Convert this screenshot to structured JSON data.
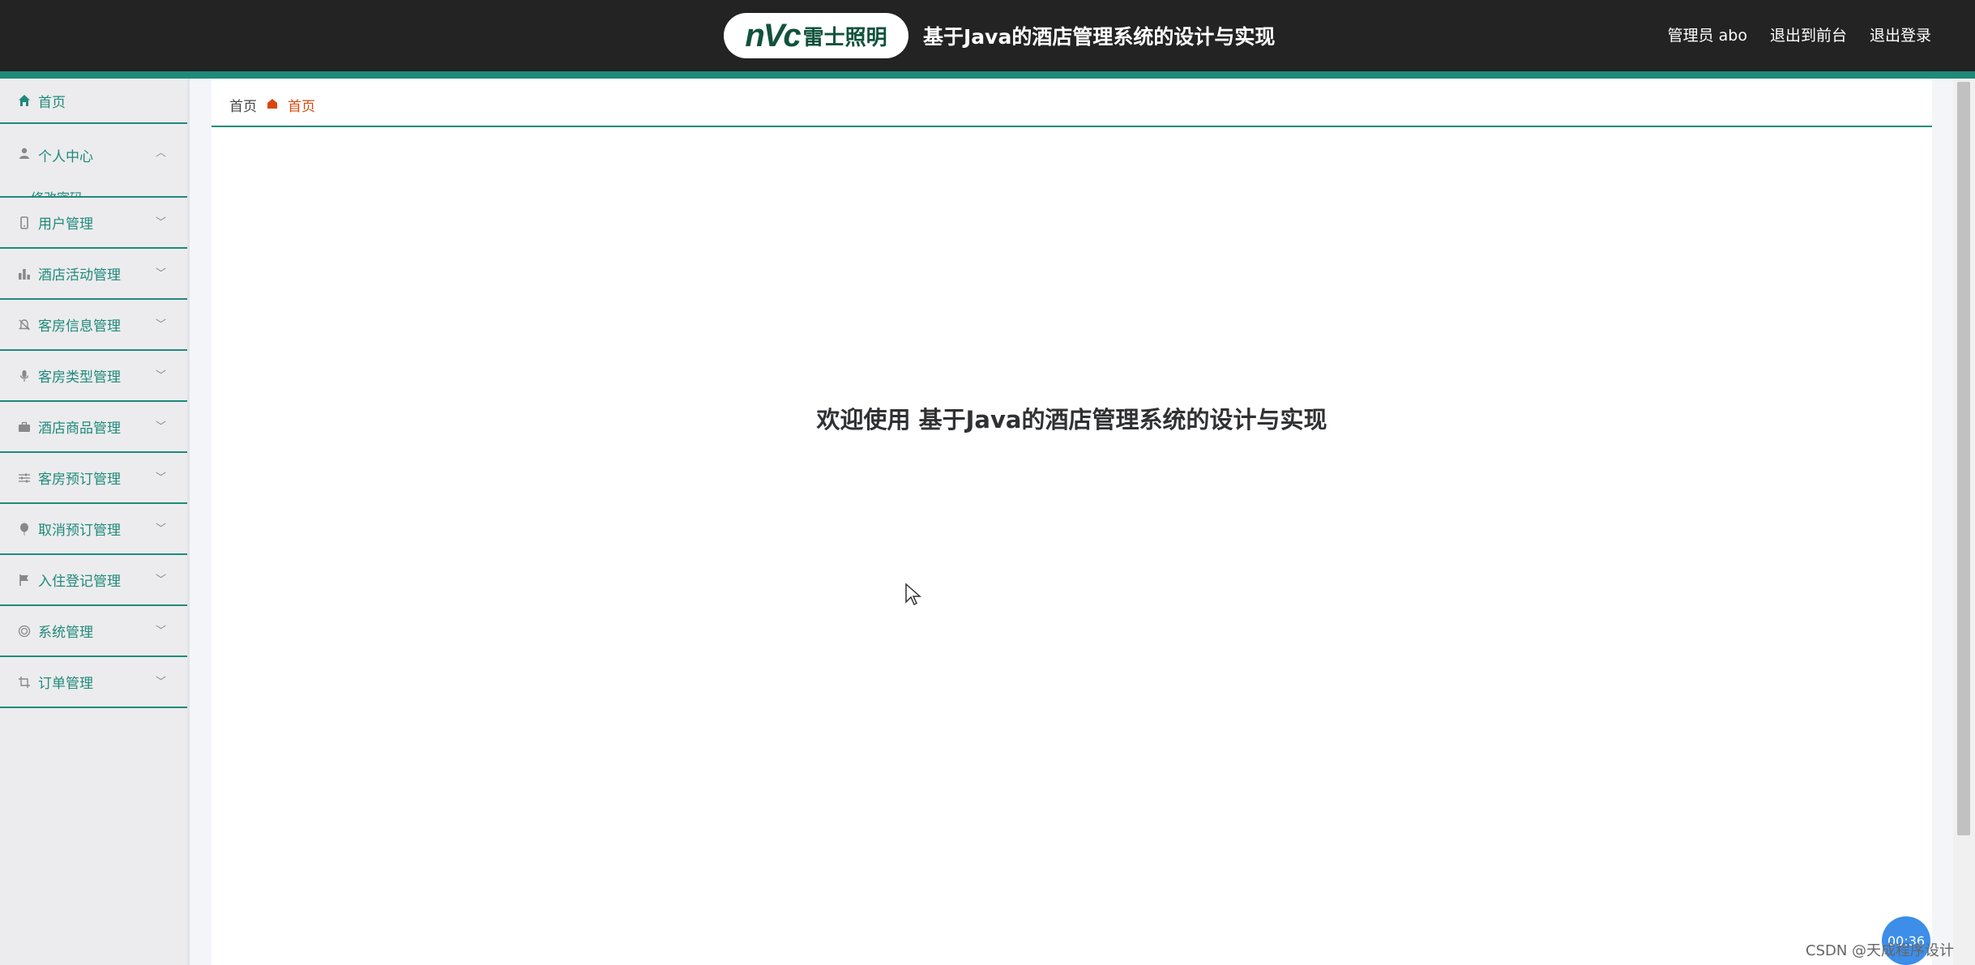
{
  "header": {
    "logo_mark": "nVc",
    "logo_text": "雷士照明",
    "title": "基于Java的酒店管理系统的设计与实现",
    "links": {
      "user": "管理员 abo",
      "to_front": "退出到前台",
      "logout": "退出登录"
    }
  },
  "sidebar": {
    "items": [
      {
        "label": "首页",
        "icon": "home-icon"
      },
      {
        "label": "个人中心",
        "icon": "user-icon",
        "submenu_peek": "修改密码"
      },
      {
        "label": "用户管理",
        "icon": "device-icon"
      },
      {
        "label": "酒店活动管理",
        "icon": "bar-chart-icon"
      },
      {
        "label": "客房信息管理",
        "icon": "bell-off-icon"
      },
      {
        "label": "客房类型管理",
        "icon": "microphone-icon"
      },
      {
        "label": "酒店商品管理",
        "icon": "briefcase-icon"
      },
      {
        "label": "客房预订管理",
        "icon": "sliders-icon"
      },
      {
        "label": "取消预订管理",
        "icon": "balloon-icon"
      },
      {
        "label": "入住登记管理",
        "icon": "flag-icon"
      },
      {
        "label": "系统管理",
        "icon": "target-icon"
      },
      {
        "label": "订单管理",
        "icon": "crop-icon"
      }
    ]
  },
  "breadcrumb": {
    "root": "首页",
    "current": "首页"
  },
  "main": {
    "welcome": "欢迎使用 基于Java的酒店管理系统的设计与实现"
  },
  "overlay": {
    "timer": "00:36",
    "watermark": "CSDN @天成程序设计"
  },
  "colors": {
    "accent": "#1f8a7a",
    "header_bg": "#232323",
    "breadcrumb_active": "#d9480f"
  }
}
